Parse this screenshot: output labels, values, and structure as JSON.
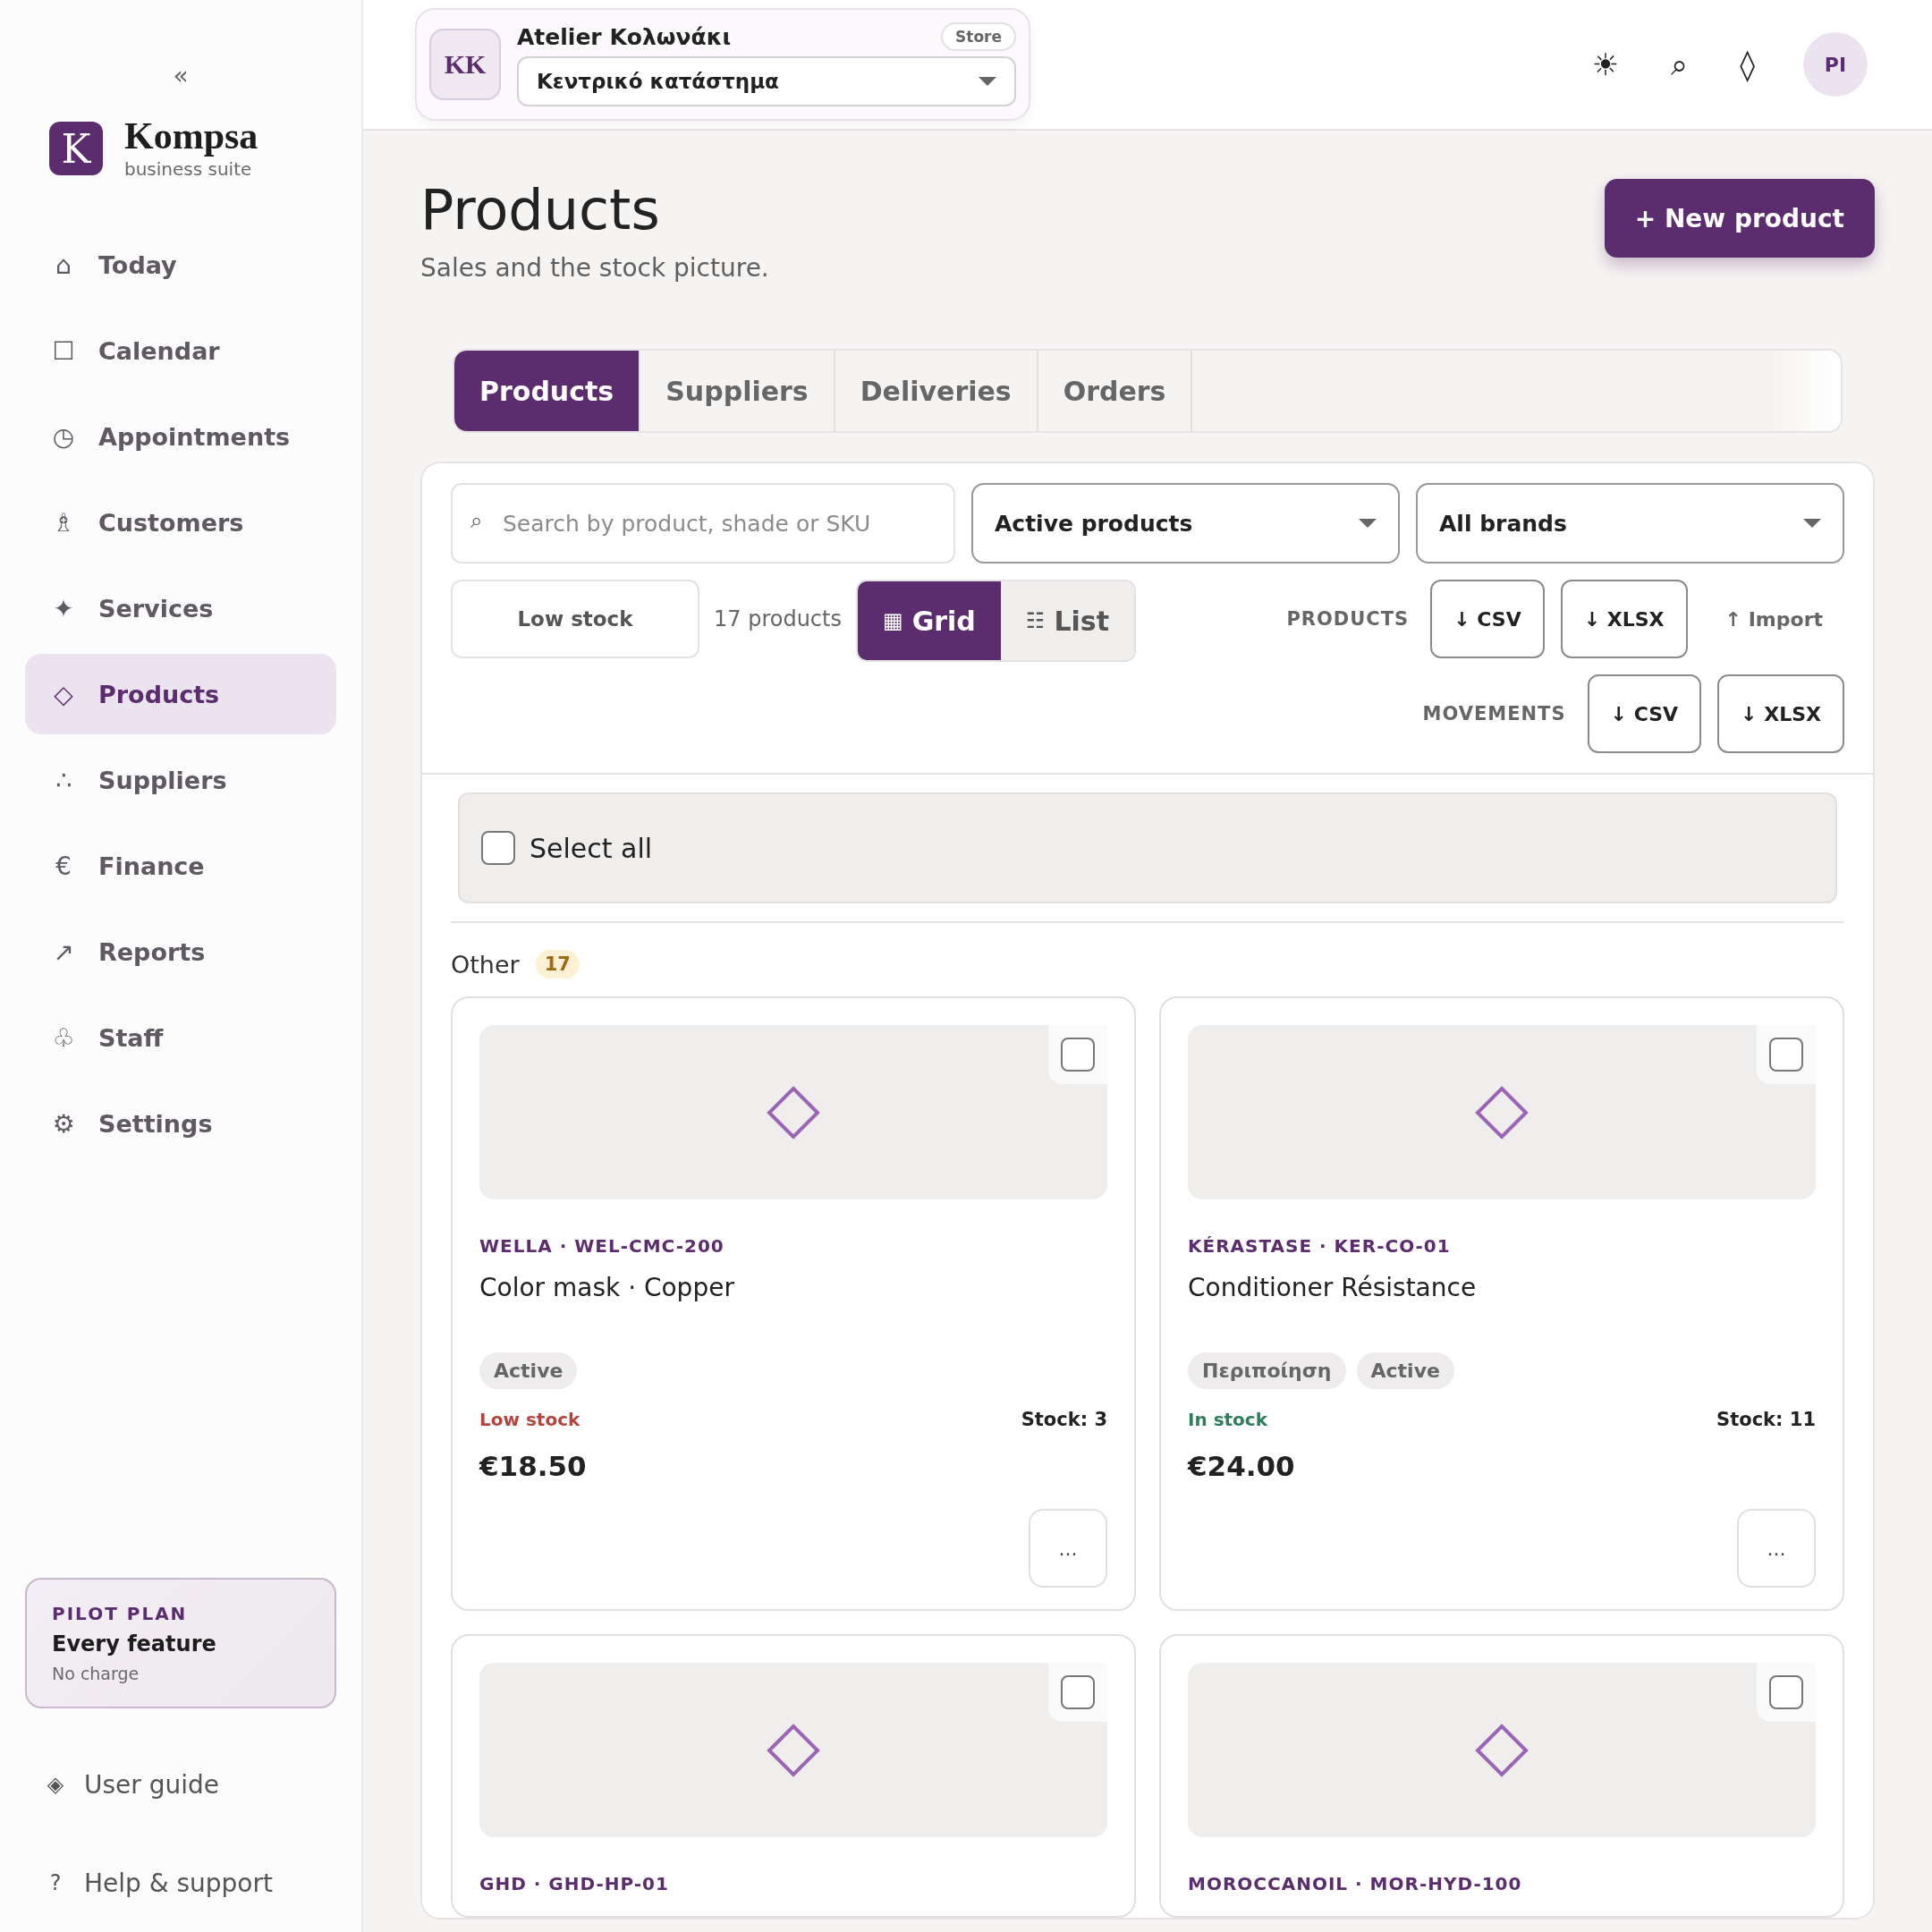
{
  "sidebar": {
    "collapse": "«",
    "brand": {
      "logo": "K",
      "name": "Kompsa",
      "tagline": "business suite"
    },
    "nav": [
      {
        "icon": "⌂",
        "label": "Today",
        "selected": false
      },
      {
        "icon": "☐",
        "label": "Calendar",
        "selected": false
      },
      {
        "icon": "◷",
        "label": "Appointments",
        "selected": false
      },
      {
        "icon": "♗",
        "label": "Customers",
        "selected": false
      },
      {
        "icon": "✦",
        "label": "Services",
        "selected": false
      },
      {
        "icon": "◇",
        "label": "Products",
        "selected": true
      },
      {
        "icon": "∴",
        "label": "Suppliers",
        "selected": false
      },
      {
        "icon": "€",
        "label": "Finance",
        "selected": false
      },
      {
        "icon": "↗",
        "label": "Reports",
        "selected": false
      },
      {
        "icon": "♧",
        "label": "Staff",
        "selected": false
      },
      {
        "icon": "⚙",
        "label": "Settings",
        "selected": false
      }
    ],
    "plan": {
      "eyebrow": "PILOT PLAN",
      "title": "Every feature",
      "note": "No charge"
    },
    "links": [
      {
        "icon": "◈",
        "label": "User guide"
      },
      {
        "icon": "?",
        "label": "Help & support"
      }
    ]
  },
  "header": {
    "store": {
      "initials": "KK",
      "name": "Atelier Κολωνάκι",
      "badge": "Store",
      "location": "Κεντρικό κατάστημα"
    },
    "icons": [
      "☀",
      "⌕",
      "◊"
    ],
    "avatar": "PI"
  },
  "page": {
    "title": "Products",
    "subtitle": "Sales and the stock picture.",
    "primary_action": "+ New product"
  },
  "tabs": [
    {
      "label": "Products",
      "selected": true
    },
    {
      "label": "Suppliers",
      "selected": false
    },
    {
      "label": "Deliveries",
      "selected": false
    },
    {
      "label": "Orders",
      "selected": false
    }
  ],
  "filters": {
    "search": {
      "icon": "⌕",
      "placeholder": "Search by product, shade or SKU"
    },
    "selects": [
      "Active products",
      "All brands"
    ],
    "low_stock": {
      "label": "Low stock",
      "selected": false
    },
    "count": "17 products",
    "views": [
      {
        "icon": "▦",
        "label": "Grid",
        "selected": true
      },
      {
        "icon": "☷",
        "label": "List",
        "selected": false
      }
    ]
  },
  "exports": [
    {
      "label": "PRODUCTS",
      "buttons": [
        {
          "kind": "outline",
          "label": "↓ CSV"
        },
        {
          "kind": "outline",
          "label": "↓ XLSX"
        },
        {
          "kind": "plain",
          "label": "↑ Import"
        }
      ]
    },
    {
      "label": "MOVEMENTS",
      "buttons": [
        {
          "kind": "outline",
          "label": "↓ CSV"
        },
        {
          "kind": "outline",
          "label": "↓ XLSX"
        }
      ]
    }
  ],
  "select_all": {
    "label": "Select all",
    "checked": false
  },
  "group": {
    "name": "Other",
    "count": "17"
  },
  "products": [
    {
      "checked": false,
      "brand_sku": "WELLA · WEL-CMC-200",
      "name": "Color mask · Copper",
      "tags": [
        "Active"
      ],
      "stock_status": {
        "kind": "low",
        "label": "Low stock"
      },
      "stock": "Stock: 3",
      "price": "€18.50",
      "menu": "..."
    },
    {
      "checked": false,
      "brand_sku": "KÉRASTASE · KER-CO-01",
      "name": "Conditioner Résistance",
      "tags": [
        "Περιποίηση",
        "Active"
      ],
      "stock_status": {
        "kind": "in",
        "label": "In stock"
      },
      "stock": "Stock: 11",
      "price": "€24.00",
      "menu": "..."
    },
    {
      "checked": false,
      "brand_sku": "GHD · GHD-HP-01"
    },
    {
      "checked": false,
      "brand_sku": "MOROCCANOIL · MOR-HYD-100"
    }
  ]
}
